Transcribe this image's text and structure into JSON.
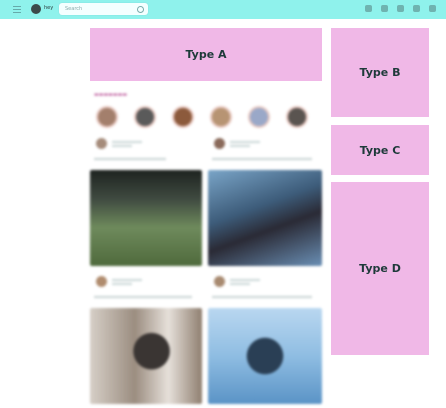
{
  "topbar": {
    "user_name": "hey",
    "search_placeholder": "Search"
  },
  "ads": {
    "a": "Type A",
    "b": "Type B",
    "c": "Type C",
    "d": "Type D"
  },
  "colors": {
    "topbar": "#8ff2ec",
    "ad_background": "#f0b8e7",
    "ad_text": "#1e3a3a"
  }
}
